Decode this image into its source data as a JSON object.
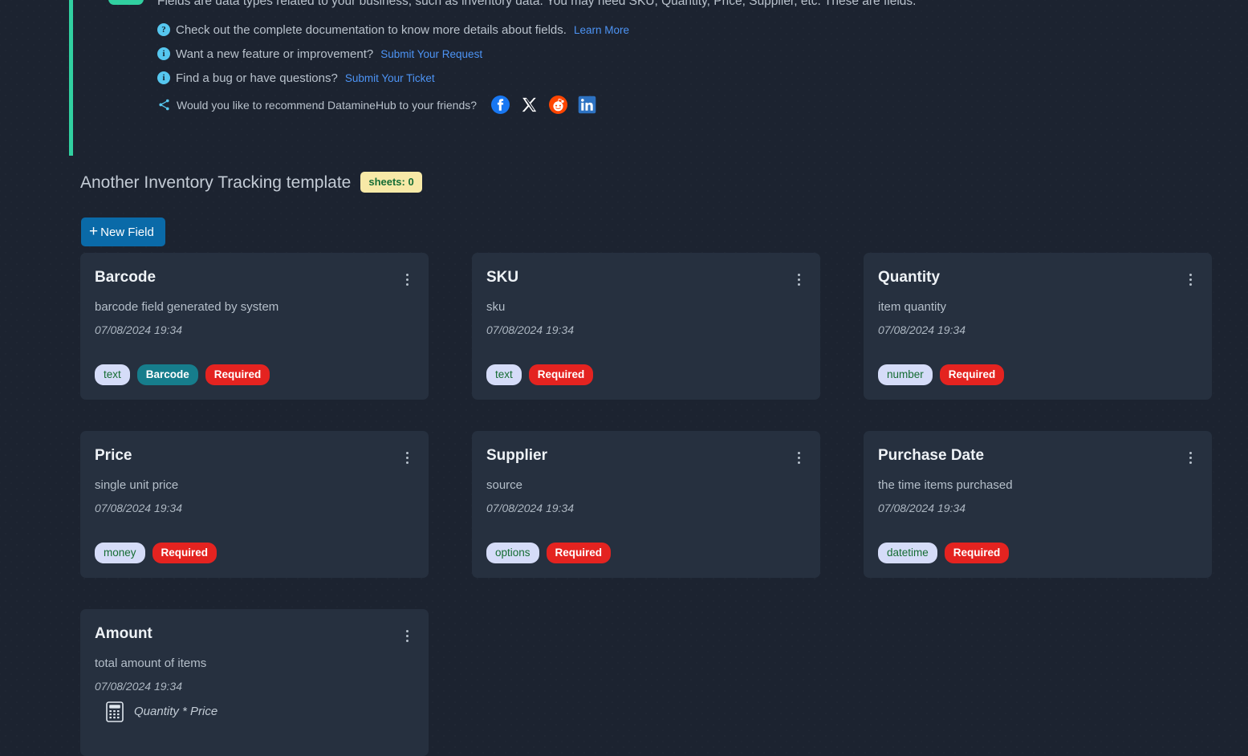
{
  "banner": {
    "lead": "Fields are data types related to your business, such as inventory data. You may need SKU, Quantity, Price, Supplier, etc. These are fields.",
    "rows": [
      {
        "icon": "question-icon",
        "glyph": "?",
        "text": "Check out the complete documentation to know more details about fields.",
        "link": "Learn More"
      },
      {
        "icon": "info-icon",
        "glyph": "i",
        "text": "Want a new feature or improvement?",
        "link": "Submit Your Request"
      },
      {
        "icon": "info-icon",
        "glyph": "i",
        "text": "Find a bug or have questions?",
        "link": "Submit Your Ticket"
      }
    ],
    "share": {
      "text": "Would you like to recommend DatamineHub to your friends?",
      "networks": [
        "facebook-icon",
        "x-twitter-icon",
        "reddit-icon",
        "linkedin-icon"
      ]
    },
    "accent_color": "#31d0a0",
    "link_color": "#4d94f5",
    "icon_color": "#56c7ef"
  },
  "section": {
    "title": "Another Inventory Tracking template",
    "sheets_badge": "sheets: 0",
    "sheets_badge_bg": "#f7e9a7",
    "sheets_badge_fg": "#156c34"
  },
  "toolbar": {
    "new_field_label": "New Field",
    "new_field_icon": "plus-icon",
    "new_field_bg": "#0a6aa8"
  },
  "colors": {
    "page_bg": "#1c2330",
    "card_bg": "#26303f",
    "tag_type_bg": "#d5dcf8",
    "tag_type_fg": "#146c32",
    "tag_special_bg": "#167d8c",
    "tag_required_bg": "#e42320"
  },
  "fields": [
    {
      "title": "Barcode",
      "description": "barcode field generated by system",
      "date": "07/08/2024 19:34",
      "formula": null,
      "tags": [
        {
          "label": "text",
          "kind": "type"
        },
        {
          "label": "Barcode",
          "kind": "special"
        },
        {
          "label": "Required",
          "kind": "required"
        }
      ]
    },
    {
      "title": "SKU",
      "description": "sku",
      "date": "07/08/2024 19:34",
      "formula": null,
      "tags": [
        {
          "label": "text",
          "kind": "type"
        },
        {
          "label": "Required",
          "kind": "required"
        }
      ]
    },
    {
      "title": "Quantity",
      "description": "item quantity",
      "date": "07/08/2024 19:34",
      "formula": null,
      "tags": [
        {
          "label": "number",
          "kind": "type"
        },
        {
          "label": "Required",
          "kind": "required"
        }
      ]
    },
    {
      "title": "Price",
      "description": "single unit price",
      "date": "07/08/2024 19:34",
      "formula": null,
      "tags": [
        {
          "label": "money",
          "kind": "type"
        },
        {
          "label": "Required",
          "kind": "required"
        }
      ]
    },
    {
      "title": "Supplier",
      "description": "source",
      "date": "07/08/2024 19:34",
      "formula": null,
      "tags": [
        {
          "label": "options",
          "kind": "type"
        },
        {
          "label": "Required",
          "kind": "required"
        }
      ]
    },
    {
      "title": "Purchase Date",
      "description": "the time items purchased",
      "date": "07/08/2024 19:34",
      "formula": null,
      "tags": [
        {
          "label": "datetime",
          "kind": "type"
        },
        {
          "label": "Required",
          "kind": "required"
        }
      ]
    },
    {
      "title": "Amount",
      "description": "total amount of items",
      "date": "07/08/2024 19:34",
      "formula": "Quantity * Price",
      "tags": []
    }
  ]
}
